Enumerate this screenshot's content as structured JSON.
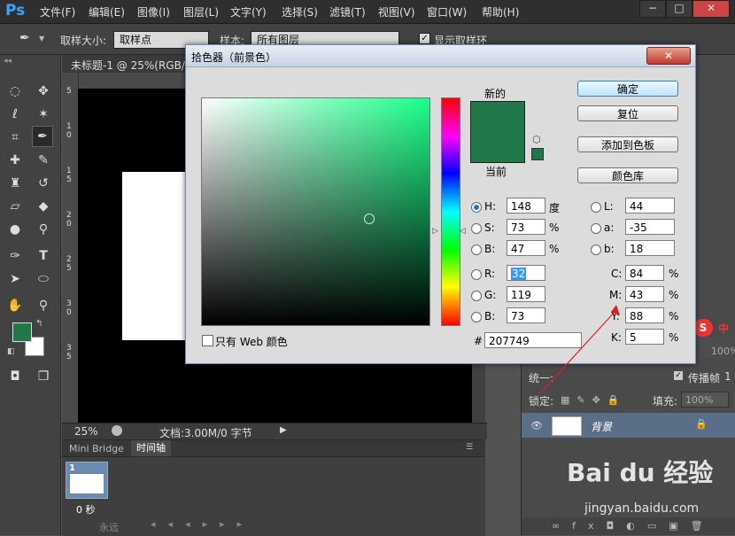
{
  "app": {
    "logo": "Ps"
  },
  "menu": [
    "文件(F)",
    "编辑(E)",
    "图像(I)",
    "图层(L)",
    "文字(Y)",
    "选择(S)",
    "滤镜(T)",
    "视图(V)",
    "窗口(W)",
    "帮助(H)"
  ],
  "window_buttons": [
    "−",
    "□",
    "✕"
  ],
  "options": {
    "sample_size_label": "取样大小:",
    "sample_size_value": "取样点",
    "sample_label": "样本:",
    "sample_value": "所有图层",
    "show_ring_label": "显示取样环"
  },
  "document": {
    "tab_title": "未标题-1 @ 25%(RGB/8",
    "zoom": "25%",
    "doc_info": "文档:3.00M/0 字节",
    "ruler_marks": [
      "5",
      "1",
      "0",
      "1",
      "5",
      "2",
      "0",
      "2",
      "5",
      "3",
      "0",
      "3",
      "5"
    ]
  },
  "timeline": {
    "tabs": [
      "Mini Bridge",
      "时间轴"
    ],
    "frame_number": "1",
    "frame_delay": "0 秒",
    "loop": "永远"
  },
  "layers": {
    "unify_label": "统一:",
    "propagate_label": "传播帧",
    "propagate_value": "1",
    "lock_label": "锁定:",
    "fill_label": "填充:",
    "fill_value": "100%",
    "opacity_value": "100%",
    "layer_name": "背景",
    "ime_label": "中"
  },
  "dialog": {
    "title": "拾色器（前景色）",
    "new_label": "新的",
    "current_label": "当前",
    "new_color": "#207749",
    "current_color": "#207749",
    "buttons": {
      "ok": "确定",
      "reset": "复位",
      "add_swatch": "添加到色板",
      "libraries": "颜色库"
    },
    "hsb": [
      {
        "label": "H:",
        "value": "148",
        "unit": "度",
        "checked": true
      },
      {
        "label": "S:",
        "value": "73",
        "unit": "%",
        "checked": false
      },
      {
        "label": "B:",
        "value": "47",
        "unit": "%",
        "checked": false
      }
    ],
    "rgb": [
      {
        "label": "R:",
        "value": "32"
      },
      {
        "label": "G:",
        "value": "119"
      },
      {
        "label": "B:",
        "value": "73"
      }
    ],
    "lab": [
      {
        "label": "L:",
        "value": "44"
      },
      {
        "label": "a:",
        "value": "-35"
      },
      {
        "label": "b:",
        "value": "18"
      }
    ],
    "cmyk": [
      {
        "label": "C:",
        "value": "84",
        "unit": "%"
      },
      {
        "label": "M:",
        "value": "43",
        "unit": "%"
      },
      {
        "label": "Y:",
        "value": "88",
        "unit": "%"
      },
      {
        "label": "K:",
        "value": "5",
        "unit": "%"
      }
    ],
    "hex_label": "#",
    "hex_value": "207749",
    "web_only_label": "只有 Web 颜色"
  },
  "watermark": {
    "brand": "Bai du 经验",
    "url": "jingyan.baidu.com"
  },
  "colors": {
    "accent_green": "#207749",
    "panel": "#535353",
    "dialog_bg": "#dcdcdc"
  }
}
